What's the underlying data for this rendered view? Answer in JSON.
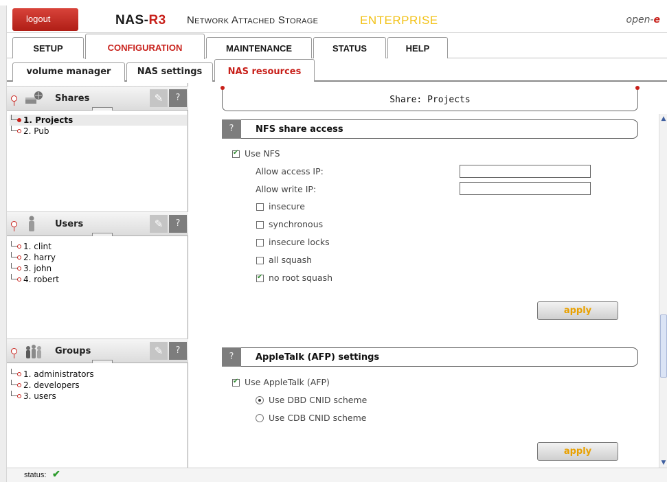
{
  "header": {
    "logout_label": "logout",
    "product_name_main": "NAS-",
    "product_name_suffix": "R3",
    "subtitle": "Network Attached Storage",
    "edition": "ENTERPRISE",
    "brand_main": "open-",
    "brand_e": "e"
  },
  "main_tabs": [
    {
      "label": "SETUP"
    },
    {
      "label": "CONFIGURATION",
      "active": true
    },
    {
      "label": "MAINTENANCE"
    },
    {
      "label": "STATUS"
    },
    {
      "label": "HELP"
    }
  ],
  "sub_tabs": [
    {
      "label": "volume manager"
    },
    {
      "label": "NAS settings"
    },
    {
      "label": "NAS resources",
      "active": true
    }
  ],
  "sidebar": {
    "shares": {
      "title": "Shares",
      "tool_icon": "wrench-icon",
      "help_label": "?",
      "items": [
        {
          "label": "1. Projects",
          "selected": true
        },
        {
          "label": "2. Pub"
        }
      ]
    },
    "users": {
      "title": "Users",
      "help_label": "?",
      "items": [
        {
          "label": "1. clint"
        },
        {
          "label": "2. harry"
        },
        {
          "label": "3. john"
        },
        {
          "label": "4. robert"
        }
      ]
    },
    "groups": {
      "title": "Groups",
      "help_label": "?",
      "items": [
        {
          "label": "1. administrators"
        },
        {
          "label": "2. developers"
        },
        {
          "label": "3. users"
        }
      ]
    }
  },
  "main": {
    "share_title": "Share: Projects",
    "nfs": {
      "title": "NFS share access",
      "help_label": "?",
      "use_nfs_label": "Use NFS",
      "use_nfs_checked": true,
      "allow_access_label": "Allow access IP:",
      "allow_access_value": "",
      "allow_write_label": "Allow write IP:",
      "allow_write_value": "",
      "options": [
        {
          "label": "insecure",
          "checked": false
        },
        {
          "label": "synchronous",
          "checked": false
        },
        {
          "label": "insecure locks",
          "checked": false
        },
        {
          "label": "all squash",
          "checked": false
        },
        {
          "label": "no root squash",
          "checked": true
        }
      ],
      "apply_label": "apply"
    },
    "afp": {
      "title": "AppleTalk (AFP) settings",
      "help_label": "?",
      "use_afp_label": "Use AppleTalk (AFP)",
      "use_afp_checked": true,
      "schemes": [
        {
          "label": "Use DBD CNID scheme",
          "selected": true
        },
        {
          "label": "Use CDB CNID scheme",
          "selected": false
        }
      ],
      "apply_label": "apply"
    }
  },
  "status": {
    "label": "status:",
    "ok_icon": "checkmark-icon",
    "ok_color": "#2a9a2a"
  },
  "colors": {
    "accent_red": "#c8201a",
    "edition_yellow": "#f2c218",
    "apply_text": "#e8a000"
  }
}
